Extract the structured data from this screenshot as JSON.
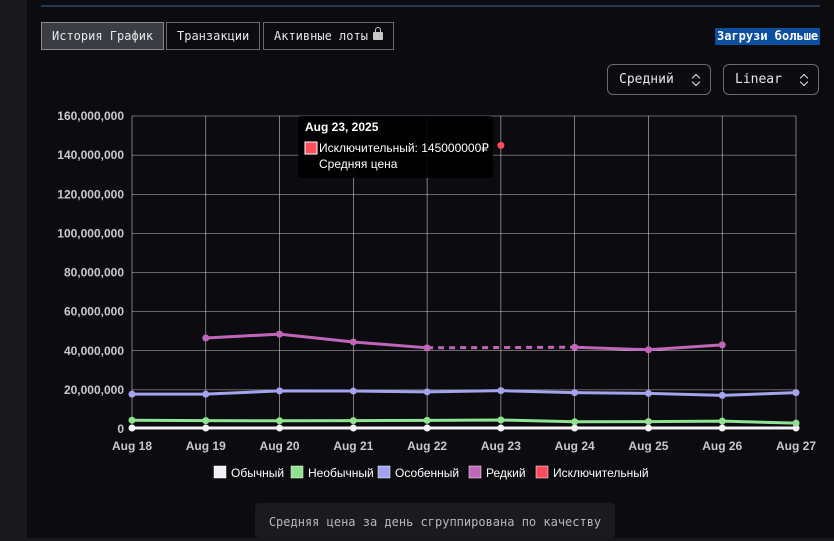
{
  "tabs": [
    {
      "label": "История График",
      "active": true
    },
    {
      "label": "Транзакции",
      "active": false
    },
    {
      "label": "Активные лоты",
      "active": false,
      "icon": "lock-icon"
    }
  ],
  "load_more_label": "Загрузи больше",
  "controls": {
    "aggregation": {
      "value": "Средний"
    },
    "scale": {
      "value": "Linear"
    }
  },
  "tooltip": {
    "date": "Aug 23, 2025",
    "line": "Исключительный: 145000000₽",
    "sub": "Средняя цена",
    "swatch_color": "#ff4d5e"
  },
  "footnote": "Средняя цена за день сгруппирована по качеству",
  "chart_data": {
    "type": "line",
    "categories": [
      "Aug 18",
      "Aug 19",
      "Aug 20",
      "Aug 21",
      "Aug 22",
      "Aug 23",
      "Aug 24",
      "Aug 25",
      "Aug 26",
      "Aug 27"
    ],
    "y_ticks": [
      "0",
      "20,000,000",
      "40,000,000",
      "60,000,000",
      "80,000,000",
      "100,000,000",
      "120,000,000",
      "140,000,000",
      "160,000,000"
    ],
    "ylim": [
      0,
      160000000
    ],
    "grid": true,
    "legend_position": "bottom",
    "series": [
      {
        "name": "Обычный",
        "color": "#f2f2f2",
        "values": [
          500000,
          500000,
          500000,
          500000,
          500000,
          500000,
          500000,
          500000,
          500000,
          500000
        ]
      },
      {
        "name": "Необычный",
        "color": "#8fe28f",
        "values": [
          4500000,
          4300000,
          4200000,
          4300000,
          4400000,
          4600000,
          3700000,
          3800000,
          4000000,
          3000000
        ]
      },
      {
        "name": "Особенный",
        "color": "#a3a3ee",
        "values": [
          17800000,
          17800000,
          19500000,
          19400000,
          19000000,
          19600000,
          18600000,
          18200000,
          17200000,
          18600000
        ]
      },
      {
        "name": "Редкий",
        "color": "#c066b8",
        "values": [
          null,
          46500000,
          48500000,
          44500000,
          41500000,
          null,
          41800000,
          40500000,
          43000000,
          null
        ],
        "dashed_gaps": [
          [
            4,
            6
          ]
        ]
      },
      {
        "name": "Исключительный",
        "color": "#ff4d5e",
        "values": [
          null,
          null,
          null,
          null,
          null,
          145000000,
          null,
          null,
          null,
          null
        ]
      }
    ]
  }
}
